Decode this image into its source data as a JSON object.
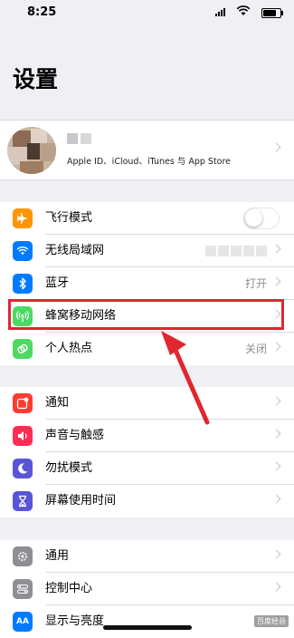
{
  "status_bar": {
    "time": "8:25"
  },
  "page_title": "设置",
  "account": {
    "subtitle": "Apple ID、iCloud、iTunes 与 App Store"
  },
  "groups": [
    {
      "items": [
        {
          "label": "飞行模式",
          "icon": "airplane-icon",
          "color": "#ff9500",
          "toggle": false
        },
        {
          "label": "无线局域网",
          "icon": "wifi-icon",
          "color": "#007aff"
        },
        {
          "label": "蓝牙",
          "icon": "bluetooth-icon",
          "color": "#007aff",
          "value": "打开"
        },
        {
          "label": "蜂窝移动网络",
          "icon": "antenna-icon",
          "color": "#4cd964"
        },
        {
          "label": "个人热点",
          "icon": "hotspot-icon",
          "color": "#4cd964",
          "value": "关闭"
        }
      ]
    },
    {
      "items": [
        {
          "label": "通知",
          "icon": "notifications-icon",
          "color": "#ff3b30"
        },
        {
          "label": "声音与触感",
          "icon": "speaker-icon",
          "color": "#ff2d55"
        },
        {
          "label": "勿扰模式",
          "icon": "moon-icon",
          "color": "#5856d6"
        },
        {
          "label": "屏幕使用时间",
          "icon": "hourglass-icon",
          "color": "#5856d6"
        }
      ]
    },
    {
      "items": [
        {
          "label": "通用",
          "icon": "gear-icon",
          "color": "#8e8e93"
        },
        {
          "label": "控制中心",
          "icon": "control-center-icon",
          "color": "#8e8e93"
        },
        {
          "label": "显示与亮度",
          "icon": "brightness-icon",
          "color": "#007aff"
        }
      ]
    }
  ],
  "annotation": {
    "highlight_color": "#e0262f"
  },
  "watermark": "百度经验"
}
